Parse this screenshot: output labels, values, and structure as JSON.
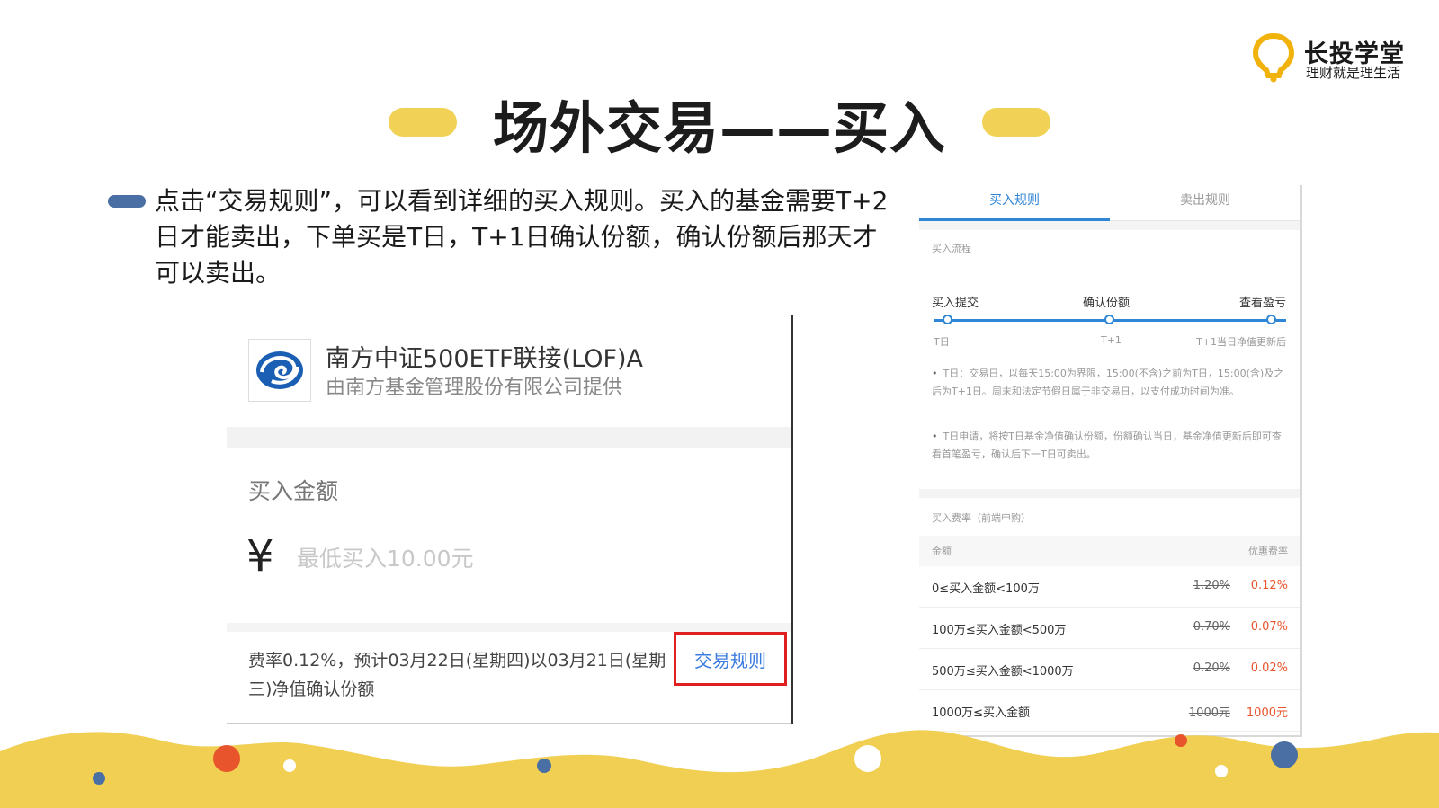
{
  "brand": {
    "name": "长投学堂",
    "slogan": "理财就是理生活",
    "color": "#f2b20c"
  },
  "title": "场外交易——买入",
  "bullet": "点击“交易规则”，可以看到详细的买入规则。买入的基金需要T+2日才能卖出，下单买是T日，T+1日确认份额，确认份额后那天才可以卖出。",
  "buy_panel": {
    "fund_name": "南方中证500ETF联接(LOF)A",
    "provider": "由南方基金管理股份有限公司提供",
    "amount_label": "买入金额",
    "currency_symbol": "¥",
    "amount_placeholder": "最低买入10.00元",
    "fee_note": "费率0.12%，预计03月22日(星期四)以03月21日(星期三)净值确认份额",
    "rules_button": "交易规则"
  },
  "rules_panel": {
    "tabs": [
      {
        "label": "买入规则",
        "active": true
      },
      {
        "label": "卖出规则",
        "active": false
      }
    ],
    "flow_title": "买入流程",
    "flow_steps": [
      {
        "label": "买入提交",
        "sub": "T日"
      },
      {
        "label": "确认份额",
        "sub": "T+1"
      },
      {
        "label": "查看盈亏",
        "sub": "T+1当日净值更新后"
      }
    ],
    "notes": [
      "T日：交易日，以每天15:00为界限，15:00(不含)之前为T日，15:00(含)及之后为T+1日。周末和法定节假日属于非交易日，以支付成功时间为准。",
      "T日申请，将按T日基金净值确认份额，份额确认当日，基金净值更新后即可查看首笔盈亏，确认后下一T日可卖出。"
    ],
    "fee_title": "买入费率（前端申购）",
    "fee_headers": {
      "amount": "金额",
      "rate": "优惠费率"
    },
    "fee_rows": [
      {
        "range": "0≤买入金额<100万",
        "original": "1.20%",
        "discount": "0.12%"
      },
      {
        "range": "100万≤买入金额<500万",
        "original": "0.70%",
        "discount": "0.07%"
      },
      {
        "range": "500万≤买入金额<1000万",
        "original": "0.20%",
        "discount": "0.02%"
      },
      {
        "range": "1000万≤买入金额",
        "original": "1000元",
        "discount": "1000元"
      }
    ]
  }
}
